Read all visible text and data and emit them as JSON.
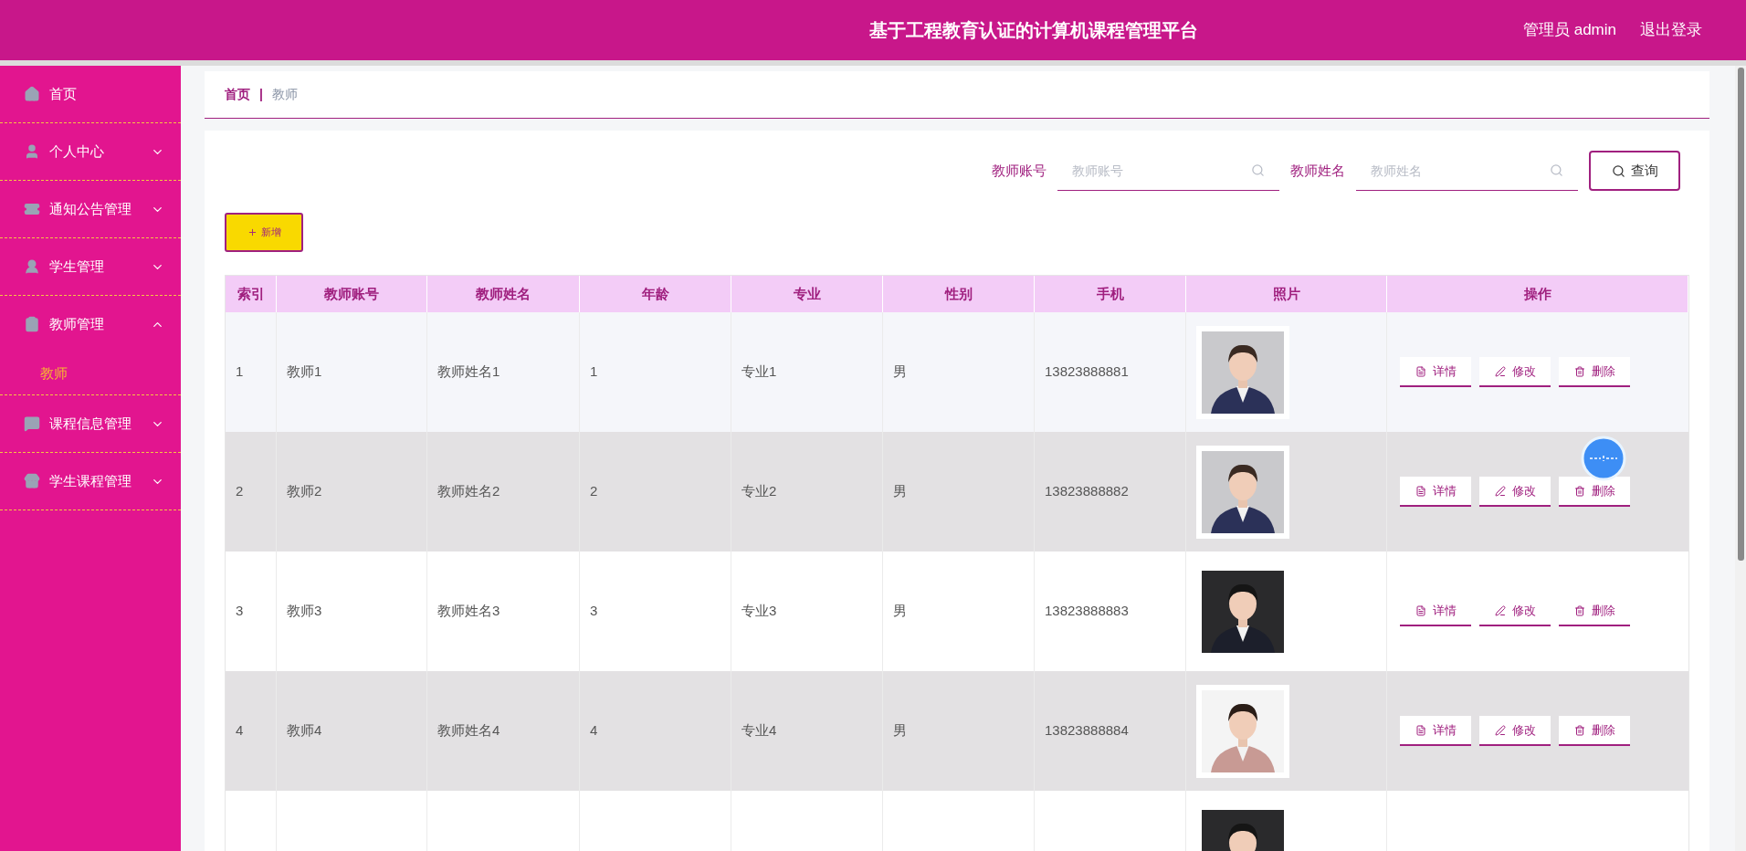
{
  "header": {
    "title": "基于工程教育认证的计算机课程管理平台",
    "user": "管理员 admin",
    "logout": "退出登录"
  },
  "sidebar": {
    "items": [
      {
        "label": "首页"
      },
      {
        "label": "个人中心",
        "expanded": false
      },
      {
        "label": "通知公告管理",
        "expanded": false
      },
      {
        "label": "学生管理",
        "expanded": false
      },
      {
        "label": "教师管理",
        "expanded": true,
        "children": [
          {
            "label": "教师",
            "selected": true
          }
        ]
      },
      {
        "label": "课程信息管理",
        "expanded": false
      },
      {
        "label": "学生课程管理",
        "expanded": false
      }
    ]
  },
  "breadcrumb": {
    "items": [
      "首页",
      "教师"
    ],
    "separator": "|"
  },
  "search": {
    "fields": [
      {
        "label": "教师账号",
        "placeholder": "教师账号"
      },
      {
        "label": "教师姓名",
        "placeholder": "教师姓名"
      }
    ],
    "button": "查询"
  },
  "add_button": "新增",
  "table": {
    "columns": [
      "索引",
      "教师账号",
      "教师姓名",
      "年龄",
      "专业",
      "性别",
      "手机",
      "照片",
      "操作"
    ],
    "rows": [
      {
        "cells": [
          "1",
          "教师1",
          "教师姓名1",
          "1",
          "专业1",
          "男",
          "13823888881"
        ],
        "photo": {
          "kind": "picture"
        },
        "actions": [
          "详情",
          "修改",
          "删除"
        ]
      },
      {
        "cells": [
          "2",
          "教师2",
          "教师姓名2",
          "2",
          "专业2",
          "男",
          "13823888882"
        ],
        "photo": {
          "kind": "picture"
        },
        "actions": [
          "详情",
          "修改",
          "删除"
        ]
      },
      {
        "cells": [
          "3",
          "教师3",
          "教师姓名3",
          "3",
          "专业3",
          "男",
          "13823888883"
        ],
        "photo": {
          "kind": "picture"
        },
        "actions": [
          "详情",
          "修改",
          "删除"
        ]
      },
      {
        "cells": [
          "4",
          "教师4",
          "教师姓名4",
          "4",
          "专业4",
          "男",
          "13823888884"
        ],
        "photo": {
          "kind": "picture"
        },
        "actions": [
          "详情",
          "修改",
          "删除"
        ]
      },
      {
        "cells": [],
        "photo": {
          "kind": "picture"
        },
        "actions": []
      }
    ]
  }
}
